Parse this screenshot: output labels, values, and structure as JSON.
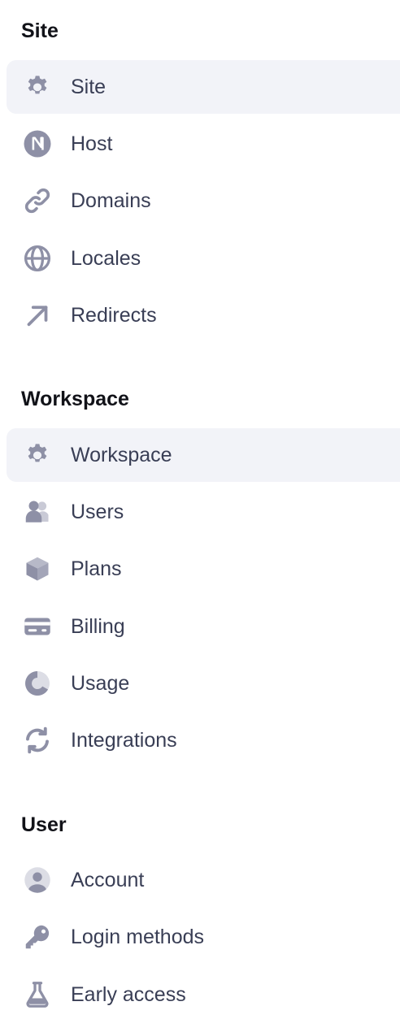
{
  "sections": [
    {
      "title": "Site",
      "items": [
        {
          "label": "Site",
          "icon": "gear-icon",
          "selected": true
        },
        {
          "label": "Host",
          "icon": "next-logo-icon"
        },
        {
          "label": "Domains",
          "icon": "link-icon"
        },
        {
          "label": "Locales",
          "icon": "globe-icon"
        },
        {
          "label": "Redirects",
          "icon": "arrow-up-right-icon"
        }
      ]
    },
    {
      "title": "Workspace",
      "items": [
        {
          "label": "Workspace",
          "icon": "gear-icon",
          "selected": true
        },
        {
          "label": "Users",
          "icon": "users-icon"
        },
        {
          "label": "Plans",
          "icon": "cube-icon"
        },
        {
          "label": "Billing",
          "icon": "credit-card-icon"
        },
        {
          "label": "Usage",
          "icon": "pie-chart-icon"
        },
        {
          "label": "Integrations",
          "icon": "refresh-icon"
        }
      ]
    },
    {
      "title": "User",
      "items": [
        {
          "label": "Account",
          "icon": "user-circle-icon"
        },
        {
          "label": "Login methods",
          "icon": "key-icon"
        },
        {
          "label": "Early access",
          "icon": "flask-icon"
        }
      ]
    }
  ],
  "colors": {
    "icon": "#8e90a6",
    "icon_light": "#c9cad6",
    "selected_bg": "#f2f3f8",
    "label": "#393e55",
    "heading": "#111218"
  }
}
